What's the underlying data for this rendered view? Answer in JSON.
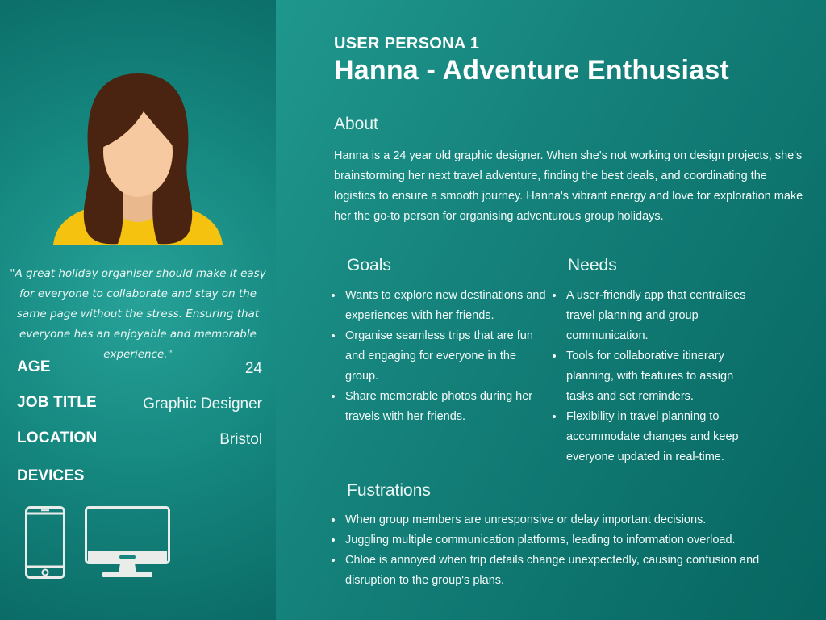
{
  "sidebar": {
    "quote": "\"A great holiday organiser should make it easy for everyone to collaborate and stay on the same page without the stress. Ensuring that everyone has an enjoyable and memorable experience.\"",
    "age_label": "AGE",
    "age_value": "24",
    "job_label": "JOB TITLE",
    "job_value": "Graphic Designer",
    "location_label": "LOCATION",
    "location_value": "Bristol",
    "devices_label": "DEVICES",
    "devices": [
      "phone-icon",
      "monitor-icon"
    ]
  },
  "header": {
    "label": "USER PERSONA 1",
    "title": "Hanna - Adventure Enthusiast"
  },
  "about": {
    "heading": "About",
    "text": "Hanna is a 24 year old graphic designer. When she's not working on design projects, she's brainstorming her next travel adventure, finding the best deals, and coordinating the logistics to ensure a smooth journey. Hanna's vibrant energy and love for exploration make her the go-to person for organising adventurous group holidays."
  },
  "goals": {
    "heading": "Goals",
    "items": [
      "Wants to explore new destinations and experiences with her friends.",
      "Organise seamless trips that are fun and engaging for everyone in the group.",
      "Share memorable photos during her travels with her friends."
    ]
  },
  "needs": {
    "heading": "Needs",
    "items": [
      "A user-friendly app that centralises travel planning and group communication.",
      "Tools for collaborative itinerary planning, with features to assign tasks and set reminders.",
      "Flexibility in travel planning to accommodate changes and keep everyone updated in real-time."
    ]
  },
  "frustrations": {
    "heading": "Fustrations",
    "items": [
      "When group members are unresponsive or delay important decisions.",
      "Juggling multiple communication platforms, leading to information overload.",
      "Chloe is annoyed when trip details change unexpectedly, causing confusion and disruption to the group's plans."
    ]
  },
  "colors": {
    "sidebar_bg": "#15877f",
    "main_bg": "#137f78",
    "hair": "#4a2410",
    "skin": "#f6c9a0",
    "shirt": "#f5c20f"
  }
}
